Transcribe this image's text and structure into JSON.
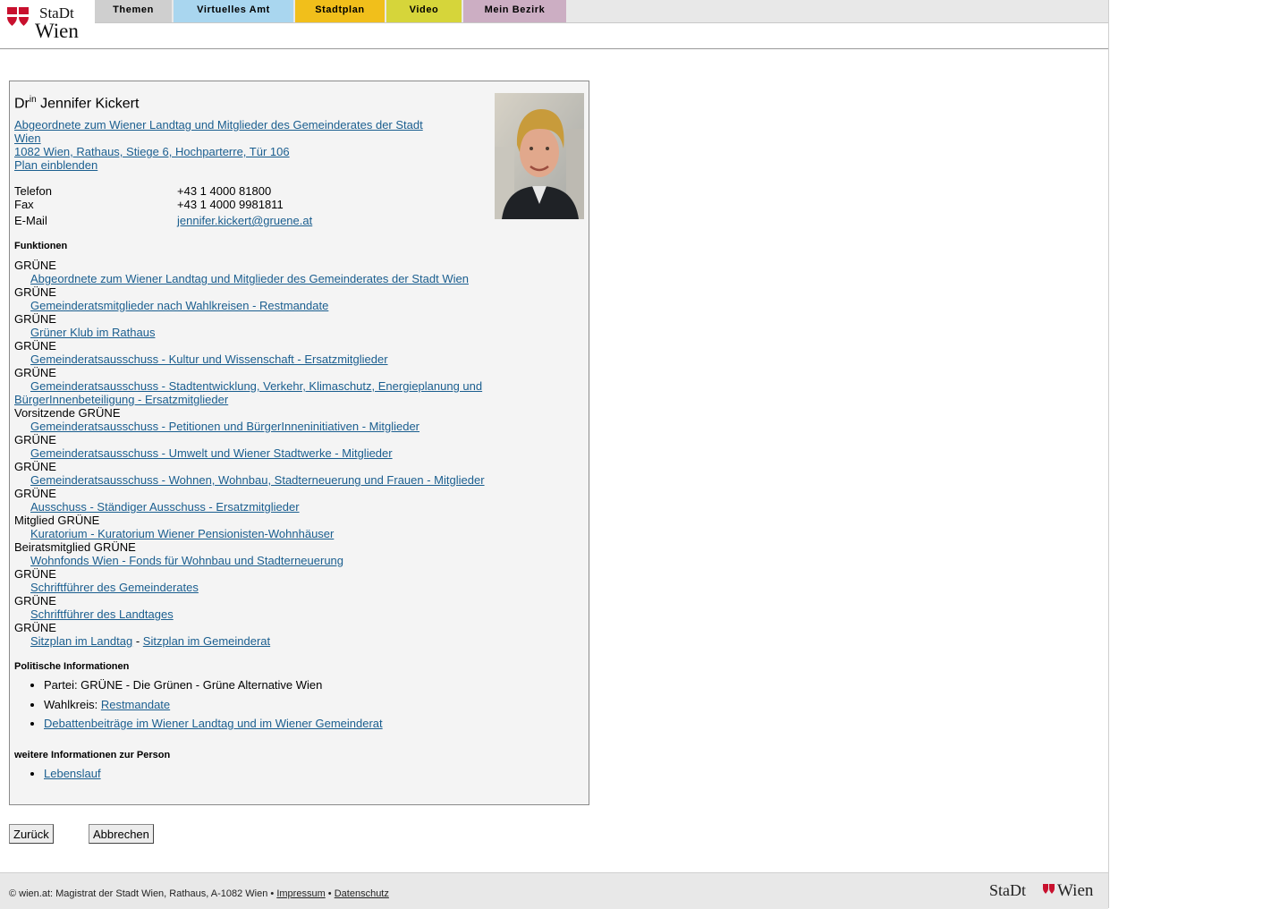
{
  "header": {
    "logo_alt": "Stadt Wien",
    "tabs": [
      {
        "label": "Themen",
        "color": "#cfcfcf"
      },
      {
        "label": "Virtuelles Amt",
        "color": "#a9d6ef"
      },
      {
        "label": "Stadtplan",
        "color": "#f1bf1b"
      },
      {
        "label": "Video",
        "color": "#d6d53a"
      },
      {
        "label": "Mein Bezirk",
        "color": "#ccaec3"
      }
    ]
  },
  "person": {
    "title_prefix": "Dr",
    "title_sup": "in",
    "name": "Jennifer Kickert",
    "role_link": "Abgeordnete zum Wiener Landtag und Mitglieder des Gemeinderates der Stadt Wien",
    "address_link": "1082 Wien, Rathaus, Stiege 6, Hochparterre, Tür 106",
    "map_link": "Plan einblenden",
    "contact": [
      {
        "label": "Telefon",
        "value": "+43 1 4000 81800"
      },
      {
        "label": "Fax",
        "value": "+43 1 4000 9981811"
      },
      {
        "label": "E-Mail",
        "value": "jennifer.kickert@gruene.at"
      }
    ]
  },
  "functions": {
    "title": "Funktionen",
    "items": [
      {
        "party": "GRÜNE",
        "link": "Abgeordnete zum Wiener Landtag und Mitglieder des Gemeinderates der Stadt Wien"
      },
      {
        "party": "GRÜNE",
        "link": "Gemeinderatsmitglieder nach Wahlkreisen - Restmandate"
      },
      {
        "party": "GRÜNE",
        "link": "Grüner Klub im Rathaus"
      },
      {
        "party": "GRÜNE",
        "link": "Gemeinderatsausschuss - Kultur und Wissenschaft - Ersatzmitglieder"
      },
      {
        "party": "GRÜNE",
        "link": "Gemeinderatsausschuss - Stadtentwicklung, Verkehr, Klimaschutz, Energieplanung und BürgerInnenbeteiligung - Ersatzmitglieder"
      },
      {
        "party": "Vorsitzende GRÜNE",
        "link": "Gemeinderatsausschuss - Petitionen und BürgerInneninitiativen - Mitglieder"
      },
      {
        "party": "GRÜNE",
        "link": "Gemeinderatsausschuss - Umwelt und Wiener Stadtwerke - Mitglieder"
      },
      {
        "party": "GRÜNE",
        "link": "Gemeinderatsausschuss - Wohnen, Wohnbau, Stadterneuerung und Frauen - Mitglieder"
      },
      {
        "party": "GRÜNE",
        "link": "Ausschuss - Ständiger Ausschuss - Ersatzmitglieder"
      },
      {
        "party": "Mitglied GRÜNE",
        "link": "Kuratorium - Kuratorium Wiener Pensionisten-Wohnhäuser"
      },
      {
        "party": "Beiratsmitglied GRÜNE",
        "link": "Wohnfonds Wien - Fonds für Wohnbau und Stadterneuerung"
      },
      {
        "party": "GRÜNE",
        "link": "Schriftführer des Gemeinderates"
      },
      {
        "party": "GRÜNE",
        "link": "Schriftführer des Landtages"
      }
    ],
    "last_party": "GRÜNE",
    "seat_link_1": "Sitzplan im Landtag",
    "seat_sep": "-",
    "seat_link_2": "Sitzplan im Gemeinderat"
  },
  "political": {
    "title": "Politische Informationen",
    "party_label": "Partei: GRÜNE - Die Grünen - Grüne Alternative Wien",
    "district_label": "Wahlkreis:",
    "district_link": "Restmandate",
    "debates_link": "Debattenbeiträge im Wiener Landtag und im Wiener Gemeinderat"
  },
  "more": {
    "title": "weitere Informationen zur Person",
    "cv_link": "Lebenslauf"
  },
  "buttons": {
    "back": "Zurück",
    "cancel": "Abbrechen"
  },
  "footer": {
    "text": "© wien.at: Magistrat der Stadt Wien, Rathaus, A-1082 Wien •",
    "impressum": "Impressum",
    "sep": "•",
    "privacy": "Datenschutz",
    "logo_alt": "Stadt Wien"
  },
  "colors": {
    "link": "#1a5e8f",
    "brand_red": "#c8102e"
  }
}
